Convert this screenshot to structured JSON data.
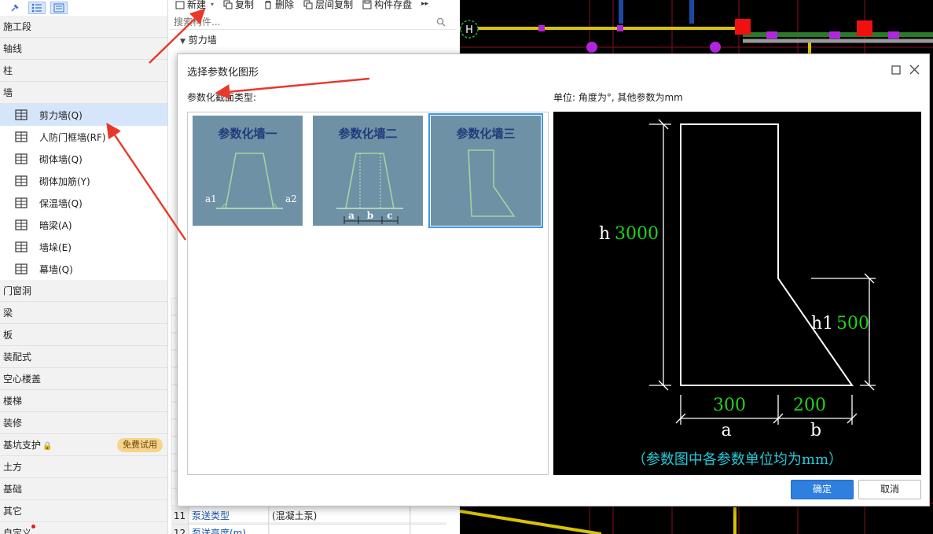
{
  "sidebar": {
    "categories_top": [
      "施工段",
      "轴线",
      "柱",
      "墙"
    ],
    "wall_items": [
      {
        "label": "剪力墙(Q)",
        "icon": "shear-wall-icon",
        "selected": true
      },
      {
        "label": "人防门框墙(RF)",
        "icon": "door-frame-wall-icon",
        "selected": false
      },
      {
        "label": "砌体墙(Q)",
        "icon": "masonry-wall-icon",
        "selected": false
      },
      {
        "label": "砌体加筋(Y)",
        "icon": "masonry-rebar-icon",
        "selected": false
      },
      {
        "label": "保温墙(Q)",
        "icon": "insulation-wall-icon",
        "selected": false
      },
      {
        "label": "暗梁(A)",
        "icon": "hidden-beam-icon",
        "selected": false
      },
      {
        "label": "墙垛(E)",
        "icon": "wall-pier-icon",
        "selected": false
      },
      {
        "label": "幕墙(Q)",
        "icon": "curtain-wall-icon",
        "selected": false
      }
    ],
    "categories_bottom": [
      "门窗洞",
      "梁",
      "板",
      "装配式",
      "空心楼盖",
      "楼梯",
      "装修",
      "基坑支护",
      "土方",
      "基础",
      "其它",
      "自定义"
    ],
    "badge_free_trial": "免费试用",
    "lock_glyph": "🔒"
  },
  "mid": {
    "toolbar": {
      "new": "新建",
      "copy": "复制",
      "delete": "删除",
      "floor_copy": "层间复制",
      "save": "构件存盘"
    },
    "search_placeholder": "搜索构件...",
    "tree_group": "剪力墙",
    "props": [
      {
        "n": "11",
        "name": "泵送类型",
        "value": "(混凝土泵)"
      },
      {
        "n": "12",
        "name": "泵送高度(m)",
        "value": ""
      }
    ]
  },
  "dialog": {
    "title": "选择参数化图形",
    "type_label": "参数化截面类型:",
    "unit_label": "单位:   角度为°, 其他参数为mm",
    "thumbs": [
      {
        "caption": "参数化墙一",
        "labels": [
          "a1",
          "a2"
        ],
        "selected": false
      },
      {
        "caption": "参数化墙二",
        "labels": [
          "a",
          "b",
          "c"
        ],
        "selected": false
      },
      {
        "caption": "参数化墙三",
        "labels": [],
        "selected": true
      }
    ],
    "preview": {
      "h_name": "h",
      "h_value": "3000",
      "h1_name": "h1",
      "h1_value": "500",
      "a_name": "a",
      "a_value": "300",
      "b_name": "b",
      "b_value": "200",
      "note": "（参数图中各参数单位均为mm）"
    },
    "ok": "确定",
    "cancel": "取消"
  },
  "canvas": {
    "axis_label": "H"
  },
  "colors": {
    "accent": "#2f7fdf",
    "arrow": "#e8382a",
    "param_value": "#22d11e",
    "note": "#26c9d9",
    "thumb_bg": "#6e91a6"
  }
}
